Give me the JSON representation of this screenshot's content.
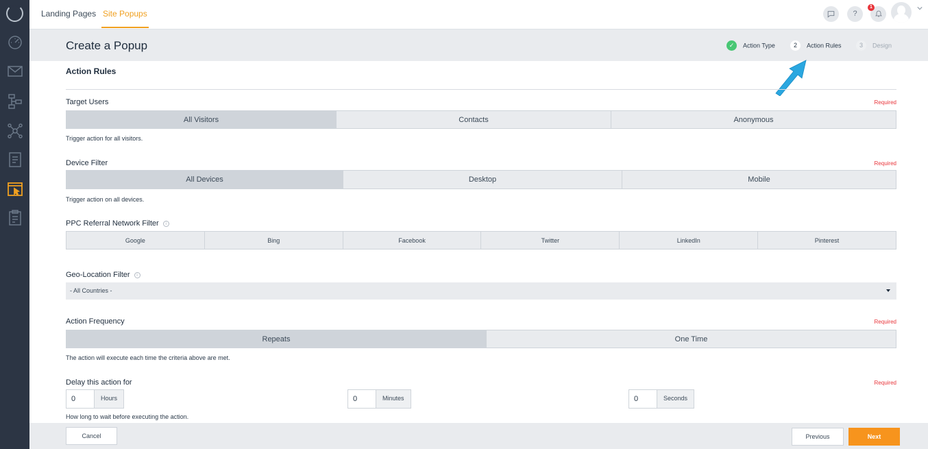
{
  "topbar": {
    "tabs": [
      {
        "label": "Landing Pages",
        "active": false
      },
      {
        "label": "Site Popups",
        "active": true
      }
    ],
    "icons": [
      "chat-icon",
      "help-icon",
      "bell-icon"
    ],
    "help_glyph": "?",
    "notification_count": "1"
  },
  "sidebar": {
    "items": [
      "dashboard-icon",
      "email-icon",
      "workflow-icon",
      "network-icon",
      "document-icon",
      "popup-icon",
      "clipboard-icon"
    ],
    "active": "popup-icon"
  },
  "header": {
    "title": "Create a Popup",
    "steps": [
      {
        "num": "✓",
        "label": "Action Type",
        "state": "done"
      },
      {
        "num": "2",
        "label": "Action Rules",
        "state": "current"
      },
      {
        "num": "3",
        "label": "Design",
        "state": "future"
      }
    ]
  },
  "main": {
    "section_title": "Action Rules",
    "required_text": "Required",
    "target_users": {
      "label": "Target Users",
      "options": [
        "All Visitors",
        "Contacts",
        "Anonymous"
      ],
      "selected": "All Visitors",
      "help": "Trigger action for all visitors."
    },
    "device_filter": {
      "label": "Device Filter",
      "options": [
        "All Devices",
        "Desktop",
        "Mobile"
      ],
      "selected": "All Devices",
      "help": "Trigger action on all devices."
    },
    "ppc_filter": {
      "label": "PPC Referral Network Filter",
      "info": "i",
      "options": [
        "Google",
        "Bing",
        "Facebook",
        "Twitter",
        "LinkedIn",
        "Pinterest"
      ]
    },
    "geo_filter": {
      "label": "Geo-Location Filter",
      "info": "i",
      "value": "- All Countries -"
    },
    "frequency": {
      "label": "Action Frequency",
      "options": [
        "Repeats",
        "One Time"
      ],
      "selected": "Repeats",
      "help": "The action will execute each time the criteria above are met."
    },
    "delay": {
      "label": "Delay this action for",
      "fields": [
        {
          "value": "0",
          "unit": "Hours"
        },
        {
          "value": "0",
          "unit": "Minutes"
        },
        {
          "value": "0",
          "unit": "Seconds"
        }
      ],
      "help": "How long to wait before executing the action."
    }
  },
  "footer": {
    "cancel": "Cancel",
    "previous": "Previous",
    "next": "Next"
  },
  "colors": {
    "accent": "#f7941d",
    "sidebar": "#2c3544",
    "required": "#e8343a",
    "step_done": "#48c774",
    "arrow": "#2aa7e0"
  }
}
